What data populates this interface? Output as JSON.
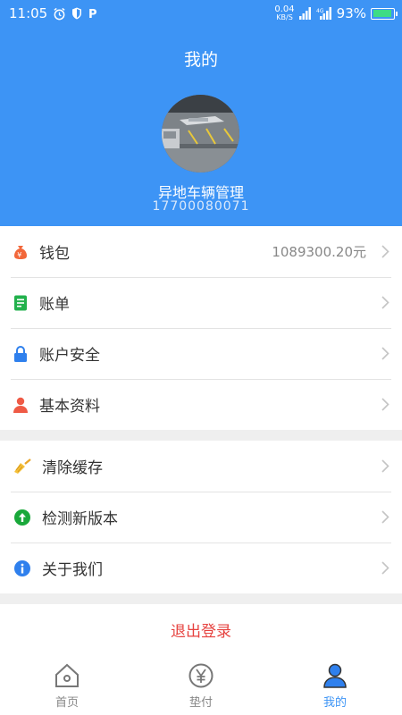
{
  "status_bar": {
    "time": "11:05",
    "net_speed_top": "0.04",
    "net_speed_unit": "KB/S",
    "battery": "93%",
    "battery_level": 0.93
  },
  "header": {
    "title": "我的",
    "user_name": "异地车辆管理",
    "user_phone": "17700080071"
  },
  "menu_group_1": [
    {
      "label": "钱包",
      "value": "1089300.20元",
      "icon": "money-bag-icon"
    },
    {
      "label": "账单",
      "icon": "bill-icon"
    },
    {
      "label": "账户安全",
      "icon": "lock-icon"
    },
    {
      "label": "基本资料",
      "icon": "person-icon"
    }
  ],
  "menu_group_2": [
    {
      "label": "清除缓存",
      "icon": "broom-icon"
    },
    {
      "label": "检测新版本",
      "icon": "upload-arrow-icon"
    },
    {
      "label": "关于我们",
      "icon": "info-icon"
    }
  ],
  "logout_label": "退出登录",
  "tabs": [
    {
      "label": "首页",
      "icon": "home-icon"
    },
    {
      "label": "垫付",
      "icon": "yen-icon"
    },
    {
      "label": "我的",
      "icon": "user-icon",
      "active": true
    }
  ],
  "colors": {
    "primary": "#3d94f5",
    "logout": "#e64340"
  }
}
